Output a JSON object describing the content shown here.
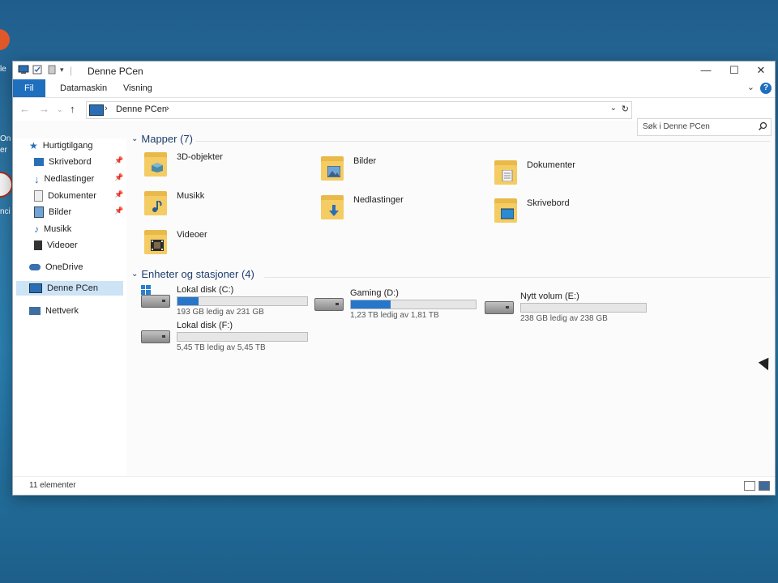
{
  "colors": {
    "accent": "#1f6fbf",
    "folder": "#f4cc63",
    "selected": "#cde3f6",
    "header": "#1e3d6e"
  },
  "desktop": {
    "labels": [
      "le",
      "On",
      "er",
      "nci"
    ]
  },
  "window": {
    "title": "Denne PCen",
    "quick_access_icons": [
      "computer-icon",
      "checkbox-icon",
      "document-icon",
      "dropdown-icon"
    ],
    "controls": {
      "minimize": "—",
      "maximize": "☐",
      "close": "✕"
    }
  },
  "ribbon": {
    "tabs": [
      "Fil",
      "Datamaskin",
      "Visning"
    ],
    "expand": "⌄",
    "help": "?"
  },
  "address": {
    "breadcrumb": "Denne PCen",
    "separator": "›",
    "dropdown": "⌄",
    "refresh": "↻"
  },
  "search": {
    "placeholder": "Søk i Denne PCen",
    "icon": "search-icon"
  },
  "sidebar": {
    "quick_access": "Hurtigtilgang",
    "items": [
      {
        "label": "Skrivebord",
        "icon": "desktop-icon",
        "pinned": true
      },
      {
        "label": "Nedlastinger",
        "icon": "download-icon",
        "pinned": true
      },
      {
        "label": "Dokumenter",
        "icon": "documents-icon",
        "pinned": true
      },
      {
        "label": "Bilder",
        "icon": "pictures-icon",
        "pinned": true
      },
      {
        "label": "Musikk",
        "icon": "music-icon",
        "pinned": false
      },
      {
        "label": "Videoer",
        "icon": "videos-icon",
        "pinned": false
      }
    ],
    "onedrive": "OneDrive",
    "this_pc": "Denne PCen",
    "network": "Nettverk"
  },
  "folders": {
    "header": "Mapper (7)",
    "items": [
      {
        "name": "3D-objekter",
        "icon": "3d-objects-icon"
      },
      {
        "name": "Bilder",
        "icon": "pictures-icon"
      },
      {
        "name": "Dokumenter",
        "icon": "documents-icon"
      },
      {
        "name": "Musikk",
        "icon": "music-icon"
      },
      {
        "name": "Nedlastinger",
        "icon": "download-icon"
      },
      {
        "name": "Skrivebord",
        "icon": "desktop-icon"
      },
      {
        "name": "Videoer",
        "icon": "videos-icon"
      }
    ]
  },
  "drives": {
    "header": "Enheter og stasjoner (4)",
    "items": [
      {
        "name": "Lokal disk (C:)",
        "free": "193 GB ledig av 231 GB",
        "used_fraction": 0.16,
        "system": true
      },
      {
        "name": "Gaming (D:)",
        "free": "1,23 TB ledig av 1,81 TB",
        "used_fraction": 0.32,
        "system": false
      },
      {
        "name": "Nytt volum (E:)",
        "free": "238 GB ledig av 238 GB",
        "used_fraction": 0.0,
        "system": false
      },
      {
        "name": "Lokal disk (F:)",
        "free": "5,45 TB ledig av 5,45 TB",
        "used_fraction": 0.0,
        "system": false
      }
    ]
  },
  "statusbar": {
    "count": "11 elementer"
  }
}
